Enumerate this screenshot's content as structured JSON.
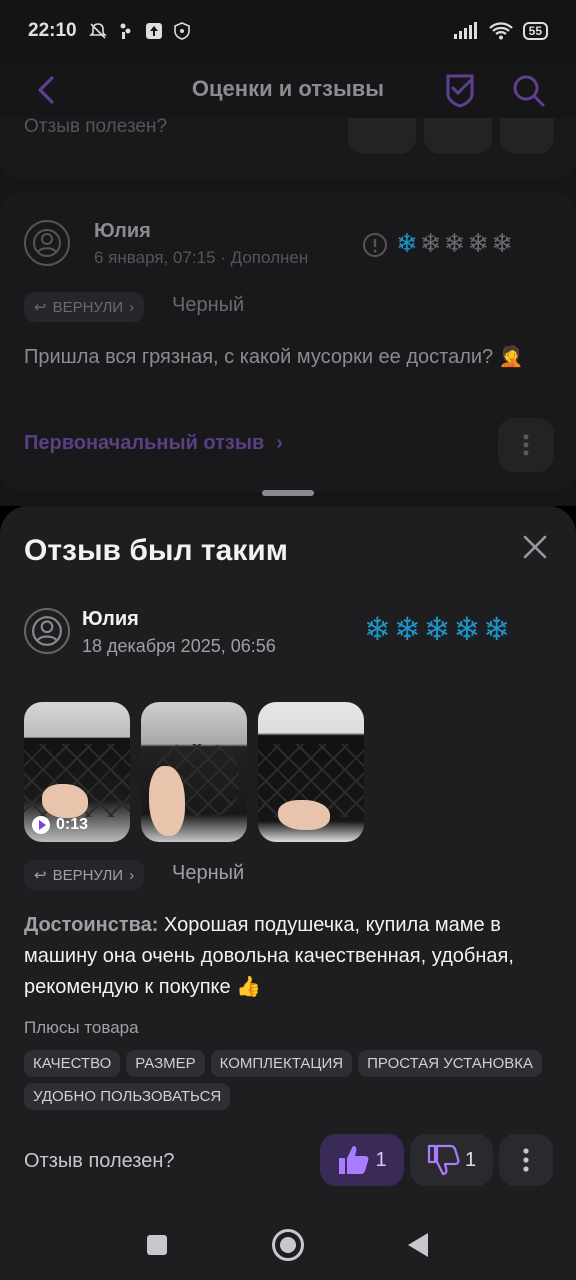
{
  "status_bar": {
    "time": "22:10",
    "battery": "55",
    "icons": [
      "mute-bell-icon",
      "usb-icon",
      "upload-icon",
      "shield-icon",
      "signal-icon",
      "wifi-icon",
      "battery-icon"
    ]
  },
  "app_bar": {
    "title": "Оценки и отзывы"
  },
  "background": {
    "previous_helpful": "Отзыв полезен?",
    "review": {
      "name": "Юлия",
      "date": "6 января, 07:15 · Дополнен",
      "rating": 1,
      "returned_label": "ВЕРНУЛИ",
      "color": "Черный",
      "text": "Пришла вся грязная, с какой мусорки ее достали? 🤦",
      "original_link": "Первоначальный отзыв"
    }
  },
  "sheet": {
    "title": "Отзыв был таким",
    "name": "Юлия",
    "date": "18 декабря 2025, 06:56",
    "rating": 5,
    "video_duration": "0:13",
    "returned_label": "ВЕРНУЛИ",
    "color": "Черный",
    "pros_label": "Достоинства:",
    "pros_text": " Хорошая подушечка, купила маме в машину она очень довольна качественная, удобная, рекомендую к покупке 👍",
    "product_pros_label": "Плюсы товара",
    "tags": [
      "КАЧЕСТВО",
      "РАЗМЕР",
      "КОМПЛЕКТАЦИЯ",
      "ПРОСТАЯ УСТАНОВКА",
      "УДОБНО ПОЛЬЗОВАТЬСЯ"
    ],
    "helpful_question": "Отзыв полезен?",
    "likes": "1",
    "dislikes": "1"
  },
  "colors": {
    "accent": "#9b6bff",
    "star": "#1a96c8",
    "sheet_bg": "#1e1e21"
  }
}
